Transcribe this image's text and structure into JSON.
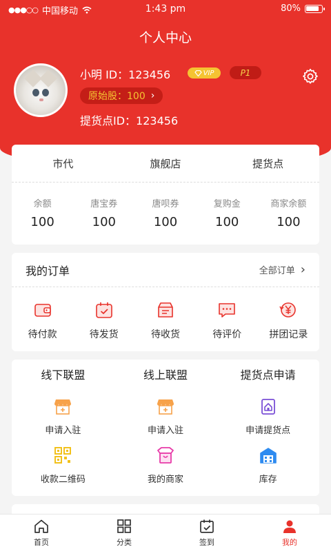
{
  "status": {
    "carrier": "中国移动",
    "time": "1:43 pm",
    "battery": "80%"
  },
  "title": "个人中心",
  "user": {
    "name_line": "小明  ID：123456",
    "vip": "VIP",
    "level": "P1",
    "shares_label": "原始股：100",
    "pickup_id": "提货点ID：123456"
  },
  "tiers": [
    "市代",
    "旗舰店",
    "提货点"
  ],
  "balances": [
    {
      "label": "余额",
      "value": "100"
    },
    {
      "label": "唐宝券",
      "value": "100"
    },
    {
      "label": "唐呗券",
      "value": "100"
    },
    {
      "label": "复购金",
      "value": "100"
    },
    {
      "label": "商家余额",
      "value": "100"
    }
  ],
  "orders": {
    "title": "我的订单",
    "all": "全部订单",
    "items": [
      {
        "label": "待付款",
        "icon": "wallet-icon"
      },
      {
        "label": "待发货",
        "icon": "calendar-check-icon"
      },
      {
        "label": "待收货",
        "icon": "box-icon"
      },
      {
        "label": "待评价",
        "icon": "chat-icon"
      },
      {
        "label": "拼团记录",
        "icon": "yen-refresh-icon"
      }
    ]
  },
  "alliance": {
    "tabs": [
      "线下联盟",
      "线上联盟",
      "提货点申请"
    ],
    "items": [
      {
        "label": "申请入驻",
        "icon": "store-icon"
      },
      {
        "label": "申请入驻",
        "icon": "store-icon"
      },
      {
        "label": "申请提货点",
        "icon": "pickup-point-icon"
      },
      {
        "label": "收款二维码",
        "icon": "qr-code-icon"
      },
      {
        "label": "我的商家",
        "icon": "shop-bag-icon"
      },
      {
        "label": "库存",
        "icon": "warehouse-icon"
      }
    ]
  },
  "tabbar": [
    {
      "label": "首页",
      "icon": "home-icon"
    },
    {
      "label": "分类",
      "icon": "grid-icon"
    },
    {
      "label": "签到",
      "icon": "checkin-icon"
    },
    {
      "label": "我的",
      "icon": "user-icon",
      "active": true
    }
  ],
  "colors": {
    "primary": "#e8322b",
    "gold": "#f5c332"
  }
}
